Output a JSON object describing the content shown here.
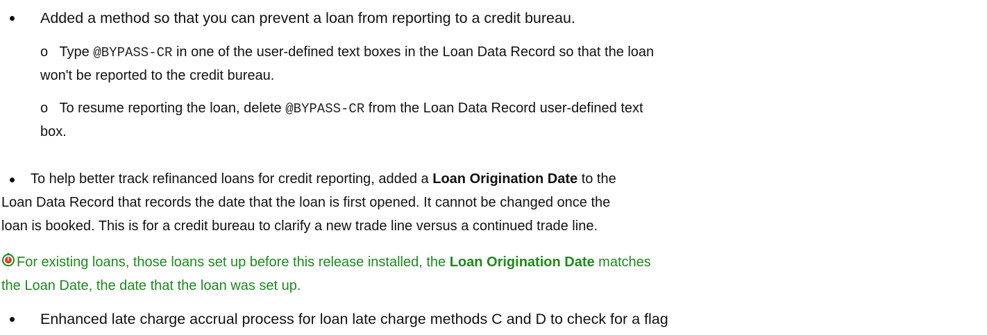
{
  "items": [
    {
      "text": "Added a method so that you can prevent a loan from reporting to a credit bureau."
    },
    {
      "sub1_pre": "Type ",
      "sub1_code": "@BYPASS-CR",
      "sub1_post": " in one of the user-defined text boxes in the Loan Data Record so that the loan",
      "sub1_line2": "won't be reported to the credit bureau."
    },
    {
      "sub2_pre": "To resume reporting the loan, delete ",
      "sub2_code": "@BYPASS-CR",
      "sub2_post": " from the Loan Data Record user-defined text",
      "sub2_line2": "box."
    },
    {
      "b2_pre": "To help better track refinanced loans for credit reporting, added a ",
      "b2_bold": "Loan Origination Date",
      "b2_post": " to the",
      "b2_line2": "Loan Data Record that records the date that the loan is first opened. It cannot be changed once the",
      "b2_line3": "loan is booked. This is for a credit bureau to clarify a new trade line versus a continued trade line."
    },
    {
      "note_pre": "For existing loans, those loans set up before this release installed, the ",
      "note_bold": "Loan Origination Date",
      "note_post": " matches",
      "note_line2": "the Loan Date, the date that the loan was set up.",
      "note_icon": "stopwatch-icon",
      "note_color": "#1b8a1b"
    },
    {
      "b3_text": "Enhanced late charge accrual process for loan late charge methods C  and D to check for a flag"
    }
  ],
  "sub_marker": "o"
}
